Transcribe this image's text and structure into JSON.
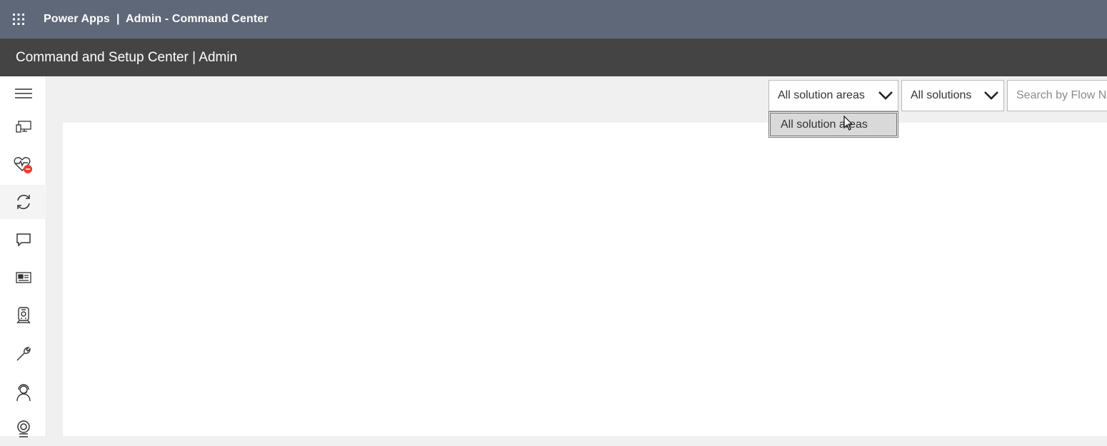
{
  "header": {
    "app_title": "Power Apps  |  Admin - Command Center",
    "waffle_icon": "waffle-icon"
  },
  "subheader": {
    "title": "Command and Setup Center | Admin"
  },
  "sidebar": {
    "items": [
      {
        "icon": "hamburger-menu-icon"
      },
      {
        "icon": "devices-icon"
      },
      {
        "icon": "health-heart-icon",
        "badge_color": "#e8402d"
      },
      {
        "icon": "sync-icon"
      },
      {
        "icon": "chat-icon"
      },
      {
        "icon": "news-icon"
      },
      {
        "icon": "train-icon"
      },
      {
        "icon": "wrench-icon"
      },
      {
        "icon": "support-agent-icon"
      },
      {
        "icon": "badge-icon"
      }
    ]
  },
  "filters": {
    "solution_areas": {
      "selected": "All solution areas",
      "options": [
        "All solution areas"
      ]
    },
    "solutions": {
      "selected": "All solutions"
    },
    "search": {
      "placeholder": "Search by Flow Name"
    }
  },
  "colors": {
    "topbar": "#5f6878",
    "subbar": "#444444",
    "badge": "#e8402d"
  }
}
